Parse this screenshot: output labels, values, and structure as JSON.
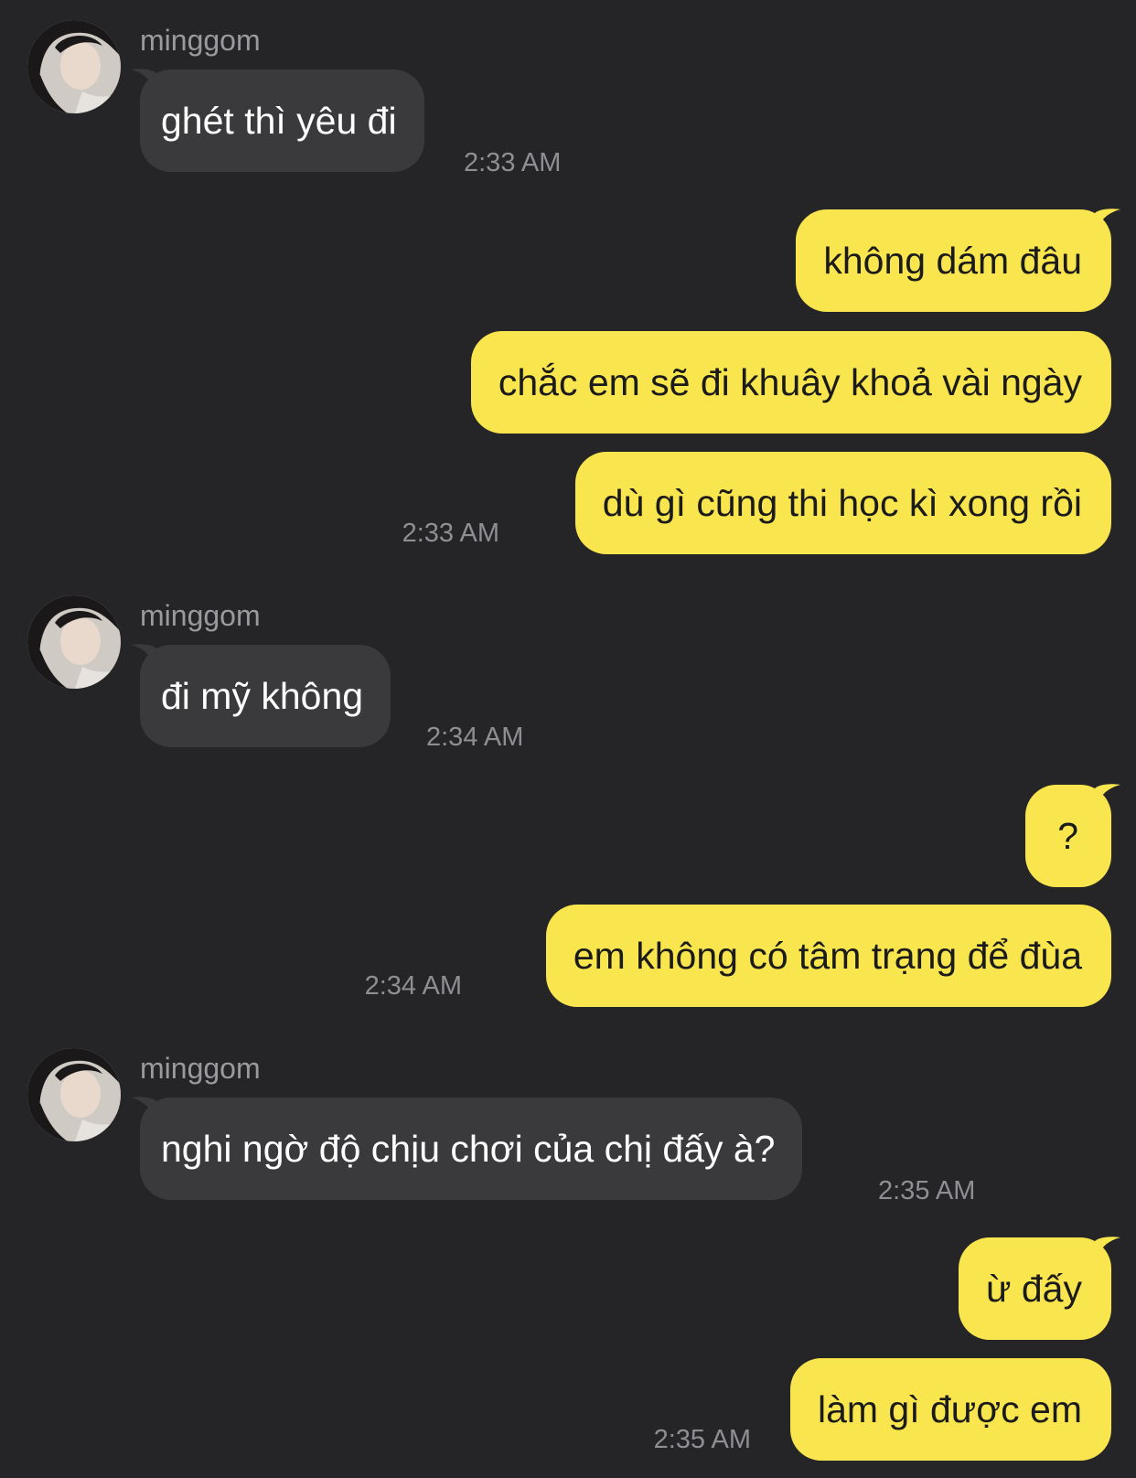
{
  "colors": {
    "background": "#252527",
    "incoming_bubble": "#3a3a3c",
    "outgoing_bubble": "#f9e54e",
    "incoming_text": "#ffffff",
    "outgoing_text": "#1b1b1b",
    "timestamp": "#8e8e93",
    "sender_name": "#9a9a9e"
  },
  "messages": [
    {
      "sender_name": "minggom",
      "text": "ghét thì yêu đi",
      "time": "2:33 AM"
    },
    {
      "text": "không dám đâu"
    },
    {
      "text": "chắc em sẽ đi khuây khoả vài ngày"
    },
    {
      "text": "dù gì cũng thi học kì xong rồi",
      "time": "2:33 AM"
    },
    {
      "sender_name": "minggom",
      "text": "đi mỹ không",
      "time": "2:34 AM"
    },
    {
      "text": "?"
    },
    {
      "text": "em không có tâm trạng để đùa",
      "time": "2:34 AM"
    },
    {
      "sender_name": "minggom",
      "text": "nghi ngờ độ chịu chơi của chị đấy à?",
      "time": "2:35 AM"
    },
    {
      "text": "ừ đấy"
    },
    {
      "text": "làm gì được em",
      "time": "2:35 AM"
    }
  ]
}
